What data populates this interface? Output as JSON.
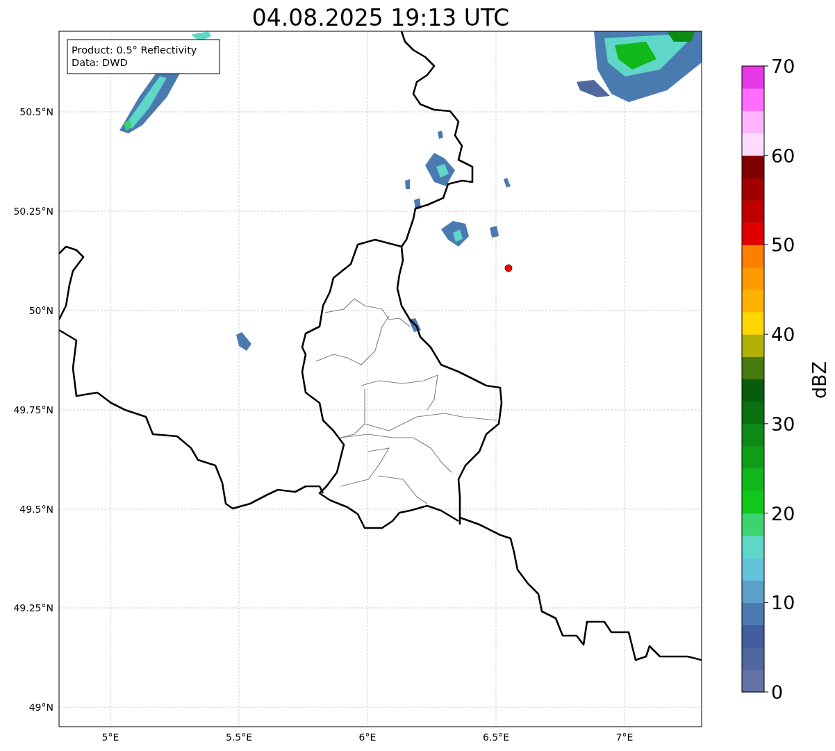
{
  "title": "04.08.2025 19:13 UTC",
  "info_box": [
    "Product: 0.5° Reflectivity",
    "Data: DWD"
  ],
  "lat_ticks": [
    "50.5°N",
    "50.25°N",
    "50°N",
    "49.75°N",
    "49.5°N",
    "49.25°N",
    "49°N"
  ],
  "lon_ticks": [
    "5°E",
    "5.5°E",
    "6°E",
    "6.5°E",
    "7°E"
  ],
  "colorbar": {
    "label": "dBZ",
    "ticks": [
      "70",
      "60",
      "50",
      "40",
      "30",
      "20",
      "10",
      "0"
    ],
    "bands": [
      {
        "color": "#6473a8"
      },
      {
        "color": "#51689f"
      },
      {
        "color": "#435ea0"
      },
      {
        "color": "#4a7bb0"
      },
      {
        "color": "#5aa0c8"
      },
      {
        "color": "#64c3dc"
      },
      {
        "color": "#5ed6c8"
      },
      {
        "color": "#3cd46e"
      },
      {
        "color": "#10c81a"
      },
      {
        "color": "#10b81a"
      },
      {
        "color": "#0f9e18"
      },
      {
        "color": "#0e8a16"
      },
      {
        "color": "#0a7010"
      },
      {
        "color": "#065e0c"
      },
      {
        "color": "#467a0c"
      },
      {
        "color": "#b0b008"
      },
      {
        "color": "#ffd700"
      },
      {
        "color": "#ffb300"
      },
      {
        "color": "#ff9900"
      },
      {
        "color": "#ff7f00"
      },
      {
        "color": "#e00000"
      },
      {
        "color": "#c00000"
      },
      {
        "color": "#a00000"
      },
      {
        "color": "#800000"
      },
      {
        "color": "#ffdcff"
      },
      {
        "color": "#ffb4ff"
      },
      {
        "color": "#ff6cff"
      },
      {
        "color": "#e838e8"
      }
    ]
  }
}
